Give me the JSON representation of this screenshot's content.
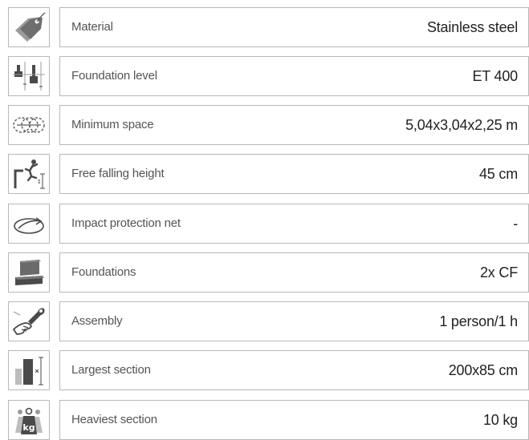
{
  "specs": [
    {
      "icon": "price-tag-icon",
      "label": "Material",
      "value": "Stainless steel"
    },
    {
      "icon": "foundation-level-icon",
      "label": "Foundation level",
      "value": "ET 400"
    },
    {
      "icon": "minimum-space-icon",
      "label": "Minimum space",
      "value": "5,04x3,04x2,25 m"
    },
    {
      "icon": "falling-person-icon",
      "label": "Free falling height",
      "value": "45 cm"
    },
    {
      "icon": "impact-net-icon",
      "label": "Impact protection net",
      "value": "-"
    },
    {
      "icon": "concrete-foundation-icon",
      "label": "Foundations",
      "value": "2x CF"
    },
    {
      "icon": "wrench-hand-icon",
      "label": "Assembly",
      "value": "1 person/1 h"
    },
    {
      "icon": "section-size-icon",
      "label": "Largest section",
      "value": "200x85 cm"
    },
    {
      "icon": "kg-weight-icon",
      "label": "Heaviest section",
      "value": "10 kg"
    }
  ],
  "icon_text": {
    "weight_unit": "kg"
  },
  "colors": {
    "border": "#b8b8b8",
    "icon_dark": "#4a4a4a",
    "icon_gray": "#9a9a9a",
    "label_text": "#555555",
    "value_text": "#222222"
  }
}
